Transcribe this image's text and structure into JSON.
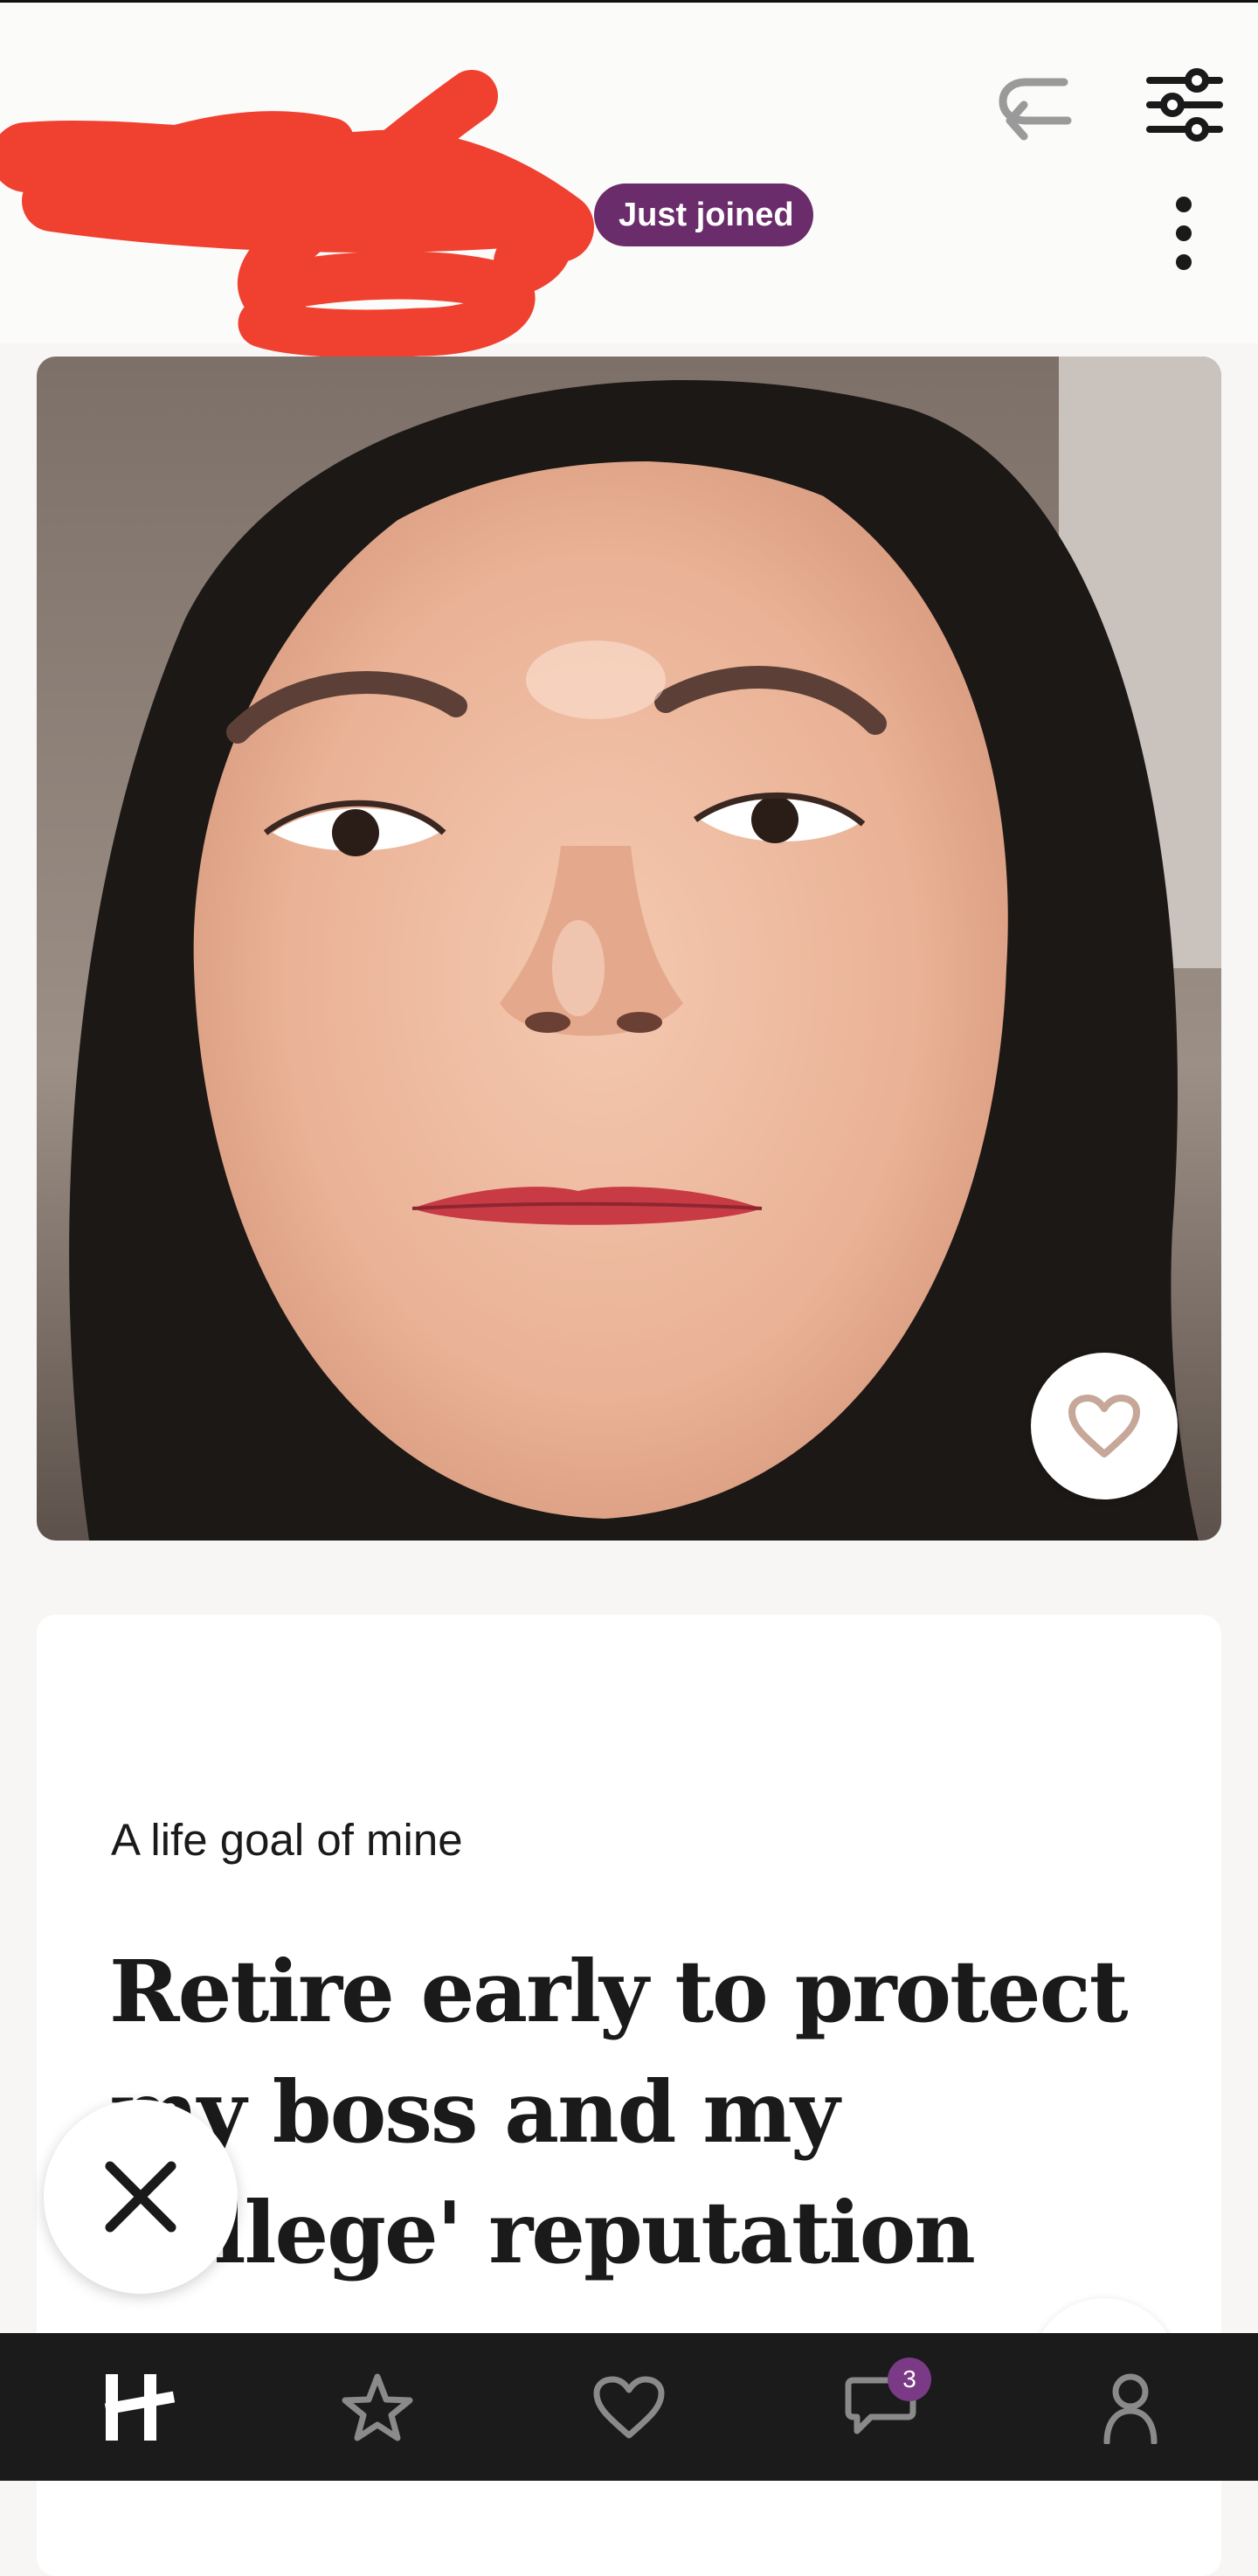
{
  "header": {
    "badge": "Just joined",
    "undo_icon": "undo-arrow-icon",
    "filter_icon": "sliders-icon",
    "more_icon": "vertical-dots-icon"
  },
  "photo": {
    "like_icon": "heart-outline-icon"
  },
  "prompt": {
    "question": "A life goal of mine",
    "answer": "Retire early to protect my boss and my college' reputation"
  },
  "actions": {
    "dismiss_icon": "x-icon"
  },
  "nav": {
    "items": [
      {
        "icon": "hinge-logo-icon"
      },
      {
        "icon": "star-icon"
      },
      {
        "icon": "heart-icon"
      },
      {
        "icon": "chat-bubbles-icon",
        "badge": "3"
      },
      {
        "icon": "profile-icon"
      }
    ]
  },
  "colors": {
    "badge": "#6a2c6a",
    "redaction": "#f0402f",
    "navbar": "#1b1b1b",
    "nav_badge": "#7b3a86"
  }
}
